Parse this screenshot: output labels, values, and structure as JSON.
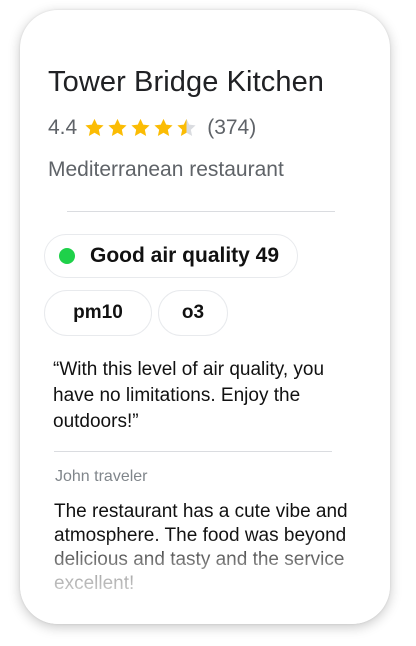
{
  "place": {
    "name": "Tower Bridge Kitchen",
    "rating": "4.4",
    "rating_value": 4.4,
    "stars_max": 5,
    "star_color": "#fbbc04",
    "review_count": "(374)",
    "category": "Mediterranean restaurant"
  },
  "air_quality": {
    "label": "Good air quality 49",
    "status_color": "#1fd14a",
    "pollutants": [
      "pm10",
      "o3"
    ],
    "quote": "“With this level of air quality, you have no limitations. Enjoy the outdoors!”"
  },
  "review": {
    "author": "John traveler",
    "text": "The restaurant has a cute vibe and atmosphere. The food was beyond delicious and tasty and the service excellent!"
  }
}
